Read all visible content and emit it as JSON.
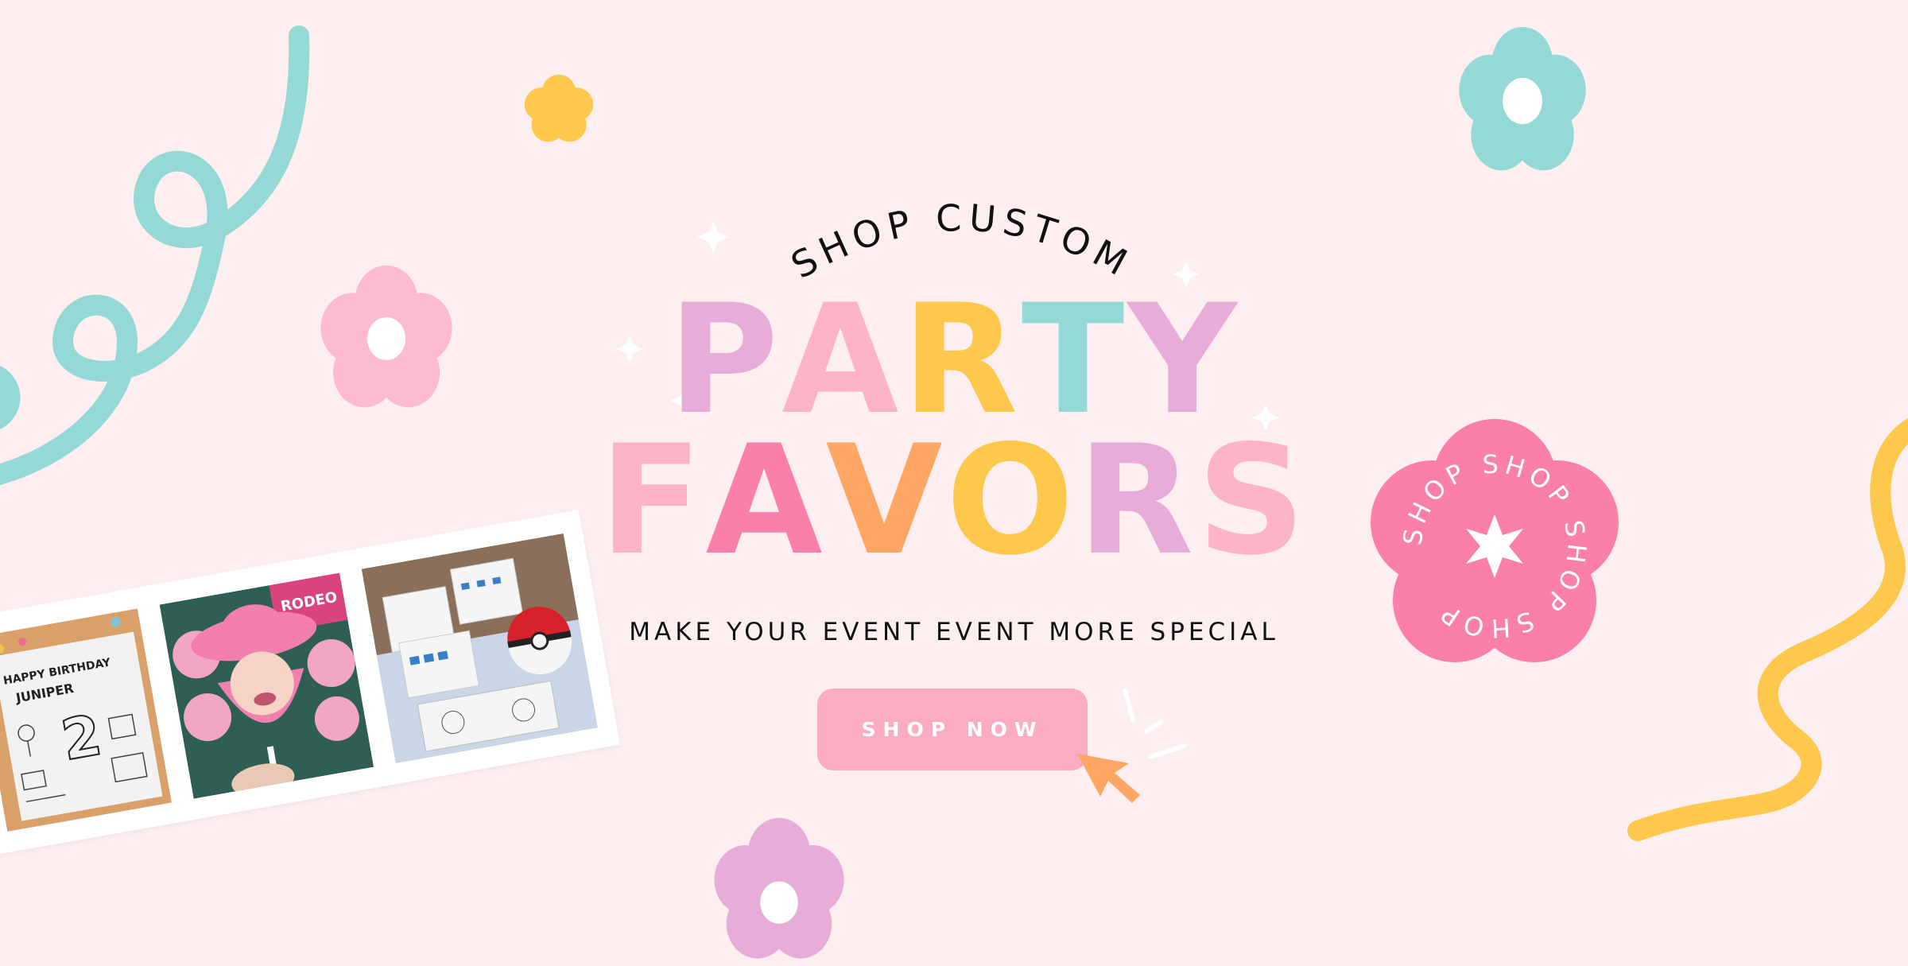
{
  "hero": {
    "eyebrow": "SHOP CUSTOM",
    "title_line1": [
      "P",
      "A",
      "R",
      "T",
      "Y"
    ],
    "title_line2": [
      "F",
      "A",
      "V",
      "O",
      "R",
      "S"
    ],
    "subtitle": "MAKE YOUR EVENT EVENT MORE SPECIAL",
    "cta_label": "SHOP NOW"
  },
  "badge": {
    "text": "SHOP SHOP SHOP SHOP "
  },
  "photos": {
    "placemat_caption_1": "HAPPY BIRTHDAY",
    "placemat_caption_2": "JUNIPER",
    "placemat_number": "2",
    "topper_caption": "RODEO"
  },
  "colors": {
    "background": "#fdeef0",
    "cta": "#fbabc2",
    "lilac": "#e8acd8",
    "pink": "#fdb4c8",
    "yellow": "#fdc84c",
    "teal": "#95d9d6",
    "hot_pink": "#fb7fab",
    "orange": "#fea664"
  }
}
